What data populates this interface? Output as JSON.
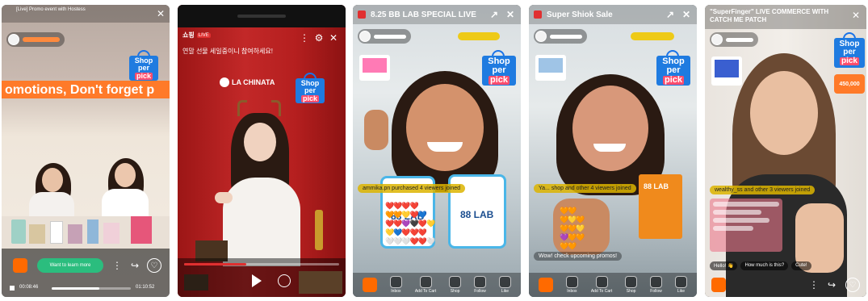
{
  "phone1": {
    "title": "[Live] Promo event with Hostess",
    "banner_text": "omotions, Don't forget p",
    "time_current": "00:08:46",
    "time_total": "01:10:52",
    "cta_label": "Want to learn more",
    "progress": 0.6
  },
  "phone2": {
    "badge_shop": "쇼핑",
    "badge_live": "LIVE",
    "headline": "연말 선물 세일중이니 참여하세요!",
    "brand": "LA CHINATA"
  },
  "phone3": {
    "title": "8.25 BB LAB SPECIAL LIVE",
    "product_left": "88 LAB",
    "product_right": "88 LAB",
    "chat": "ammika.pn purchased 4 viewers joined",
    "tools": [
      "Inbox",
      "Add To Cart",
      "Shop",
      "Follow",
      "Like"
    ]
  },
  "phone4": {
    "title": "Super Shiok Sale",
    "chat": "Ya... shop and other 4 viewers joined",
    "product": "88 LAB",
    "promo": "Wow! check upcoming promos!",
    "tools": [
      "Inbox",
      "Add To Cart",
      "Shop",
      "Follow",
      "Like"
    ]
  },
  "phone5": {
    "title": "\"SuperFinger\" LIVE COMMERCE WITH CATCH ME PATCH",
    "chat": "wealthy_ss and other 3 viewers joined",
    "price_tag": "450,000",
    "replies": [
      "Hello! 👋",
      "How much is this?",
      "Cute!"
    ]
  },
  "shop_bag": {
    "line1": "Shop",
    "line2": "per",
    "line3": "pick"
  },
  "colors": {
    "brand_blue": "#1f7be0",
    "cart_orange": "#ff6a00",
    "live_red": "#e03030"
  }
}
